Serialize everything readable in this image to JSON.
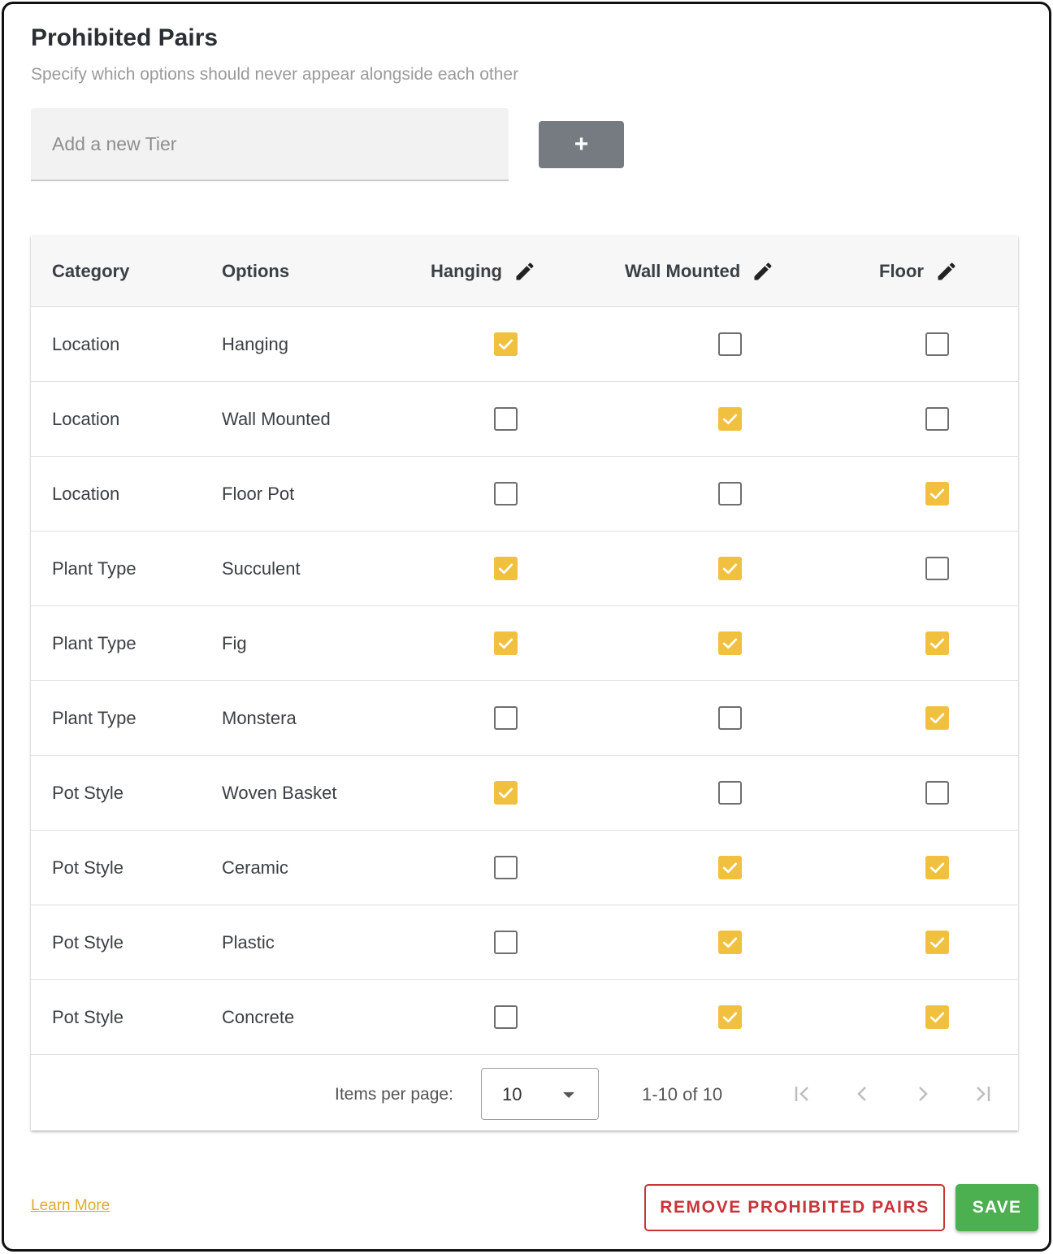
{
  "header": {
    "title": "Prohibited Pairs",
    "subtitle": "Specify which options should never appear alongside each other"
  },
  "new_tier": {
    "placeholder": "Add a new Tier",
    "value": "",
    "add_button_label": "+"
  },
  "table": {
    "columns": {
      "category": "Category",
      "options": "Options",
      "tier_1": "Hanging",
      "tier_2": "Wall Mounted",
      "tier_3": "Floor"
    },
    "rows": [
      {
        "category": "Location",
        "option": "Hanging",
        "hanging": true,
        "wall_mounted": false,
        "floor": false
      },
      {
        "category": "Location",
        "option": "Wall Mounted",
        "hanging": false,
        "wall_mounted": true,
        "floor": false
      },
      {
        "category": "Location",
        "option": "Floor Pot",
        "hanging": false,
        "wall_mounted": false,
        "floor": true
      },
      {
        "category": "Plant Type",
        "option": "Succulent",
        "hanging": true,
        "wall_mounted": true,
        "floor": false
      },
      {
        "category": "Plant Type",
        "option": "Fig",
        "hanging": true,
        "wall_mounted": true,
        "floor": true
      },
      {
        "category": "Plant Type",
        "option": "Monstera",
        "hanging": false,
        "wall_mounted": false,
        "floor": true
      },
      {
        "category": "Pot Style",
        "option": "Woven Basket",
        "hanging": true,
        "wall_mounted": false,
        "floor": false
      },
      {
        "category": "Pot Style",
        "option": "Ceramic",
        "hanging": false,
        "wall_mounted": true,
        "floor": true
      },
      {
        "category": "Pot Style",
        "option": "Plastic",
        "hanging": false,
        "wall_mounted": true,
        "floor": true
      },
      {
        "category": "Pot Style",
        "option": "Concrete",
        "hanging": false,
        "wall_mounted": true,
        "floor": true
      }
    ]
  },
  "paginator": {
    "items_per_page_label": "Items per page:",
    "items_per_page_value": "10",
    "range_label": "1-10 of 10"
  },
  "footer": {
    "learn_more": "Learn More",
    "remove_label": "REMOVE PROHIBITED PAIRS",
    "save_label": "SAVE"
  },
  "colors": {
    "checked": "#f0c03e",
    "save": "#4caf50",
    "remove": "#c7343a",
    "link": "#e0a92b"
  }
}
